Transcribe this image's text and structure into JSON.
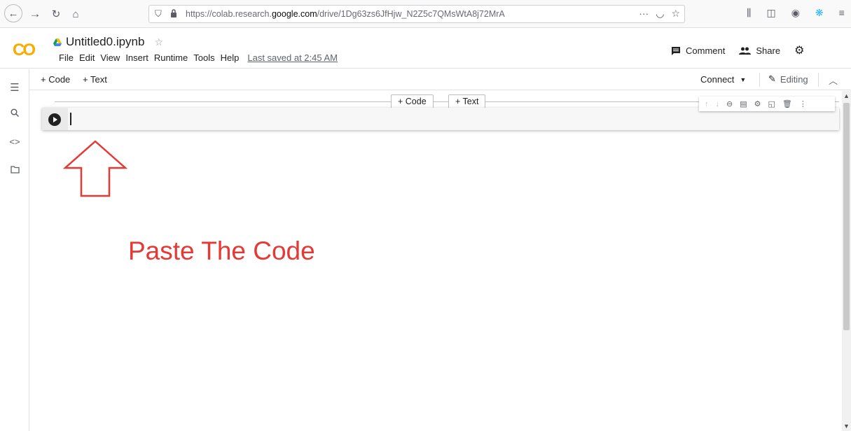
{
  "browser": {
    "url_prefix": "https://colab.research.",
    "url_domain": "google.com",
    "url_path": "/drive/1Dg63zs6JfHjw_N2Z5c7QMsWtA8j72MrA",
    "more": "···"
  },
  "header": {
    "logo": "CO",
    "title": "Untitled0.ipynb",
    "menu": [
      "File",
      "Edit",
      "View",
      "Insert",
      "Runtime",
      "Tools",
      "Help"
    ],
    "last_saved": "Last saved at 2:45 AM",
    "comment_label": "Comment",
    "share_label": "Share"
  },
  "toolbar": {
    "add_code": "+ Code",
    "add_text": "+ Text",
    "connect_label": "Connect",
    "editing_label": "Editing"
  },
  "insert_bar": {
    "code": "+ Code",
    "text": "+ Text"
  },
  "annotation": {
    "text": "Paste The Code",
    "color": "#e53935"
  },
  "colors": {
    "logo_yellow": "#f9ab00",
    "logo_orange": "#e8710a",
    "annotation_red": "#e53935"
  }
}
